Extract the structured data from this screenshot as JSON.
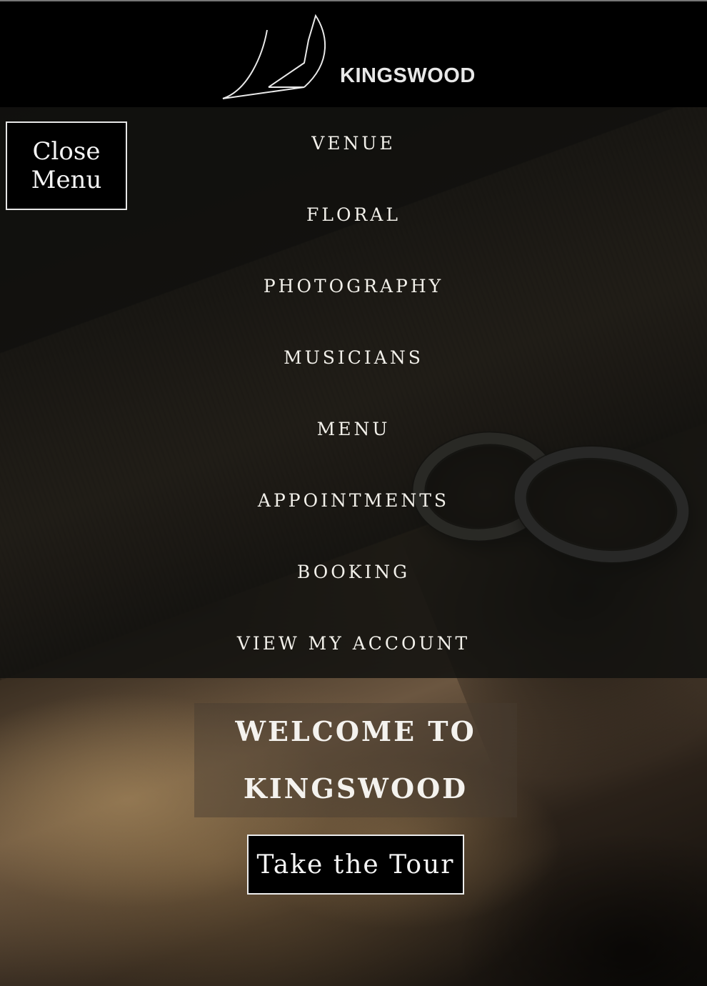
{
  "header": {
    "brand": "KINGSWOOD",
    "logo_icon": "sailboat-logo-icon"
  },
  "close_menu": {
    "label": "Close Menu"
  },
  "nav": {
    "items": [
      {
        "label": "VENUE"
      },
      {
        "label": "FLORAL"
      },
      {
        "label": "PHOTOGRAPHY"
      },
      {
        "label": "MUSICIANS"
      },
      {
        "label": "MENU"
      },
      {
        "label": "APPOINTMENTS"
      },
      {
        "label": "BOOKING"
      },
      {
        "label": "VIEW MY ACCOUNT"
      }
    ]
  },
  "hero": {
    "welcome_title": "WELCOME TO KINGSWOOD",
    "tour_button": "Take the Tour"
  },
  "colors": {
    "header_bg": "#000000",
    "text": "#f2f0ea",
    "overlay": "#12110f"
  }
}
